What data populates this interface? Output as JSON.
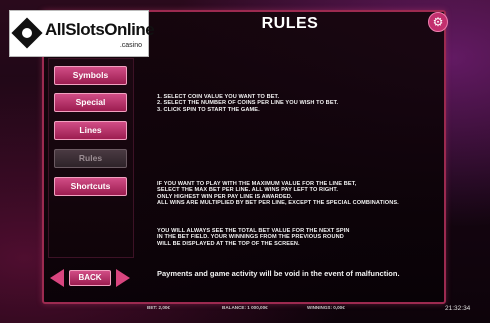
{
  "logo": {
    "name": "AllSlotsOnline",
    "sub": ".casino"
  },
  "header": {
    "title": "RULES",
    "settings_icon": "gear-icon"
  },
  "nav": {
    "items": [
      {
        "label": "Symbols",
        "active": true
      },
      {
        "label": "Special",
        "active": true
      },
      {
        "label": "Lines",
        "active": true
      },
      {
        "label": "Rules",
        "active": false
      },
      {
        "label": "Shortcuts",
        "active": true
      }
    ],
    "back_label": "BACK",
    "prev_icon": "arrow-left-icon",
    "next_icon": "arrow-right-icon"
  },
  "rules": {
    "steps": [
      "1. SELECT COIN VALUE YOU WANT TO BET.",
      "2. SELECT THE NUMBER OF COINS PER LINE YOU WISH TO BET.",
      "3. CLICK SPIN TO START THE GAME."
    ],
    "paragraph1": [
      "IF YOU WANT TO PLAY WITH THE MAXIMUM VALUE FOR THE LINE BET,",
      "SELECT THE MAX BET PER LINE. ALL WINS PAY LEFT TO RIGHT.",
      "ONLY HIGHEST WIN PER PAY LINE IS AWARDED.",
      "ALL WINS ARE MULTIPLIED BY BET PER LINE, EXCEPT THE SPECIAL COMBINATIONS."
    ],
    "paragraph2": [
      "YOU WILL ALWAYS SEE THE TOTAL BET VALUE FOR THE NEXT SPIN",
      "IN THE BET FIELD. YOUR WINNINGS FROM THE PREVIOUS ROUND",
      "WILL BE DISPLAYED AT THE TOP OF THE SCREEN."
    ],
    "malfunction_note": "Payments and game activity will be void in the event of malfunction."
  },
  "status": {
    "bet": "BET: 2,00€",
    "balance": "BALANCE: 1 000,00€",
    "winnings": "WINNINGS: 0,00€",
    "clock": "21:32:34"
  },
  "colors": {
    "accent": "#c2306e",
    "button_top": "#d14d86",
    "button_bottom": "#9c1d50",
    "frame_border": "#9c2a50"
  }
}
